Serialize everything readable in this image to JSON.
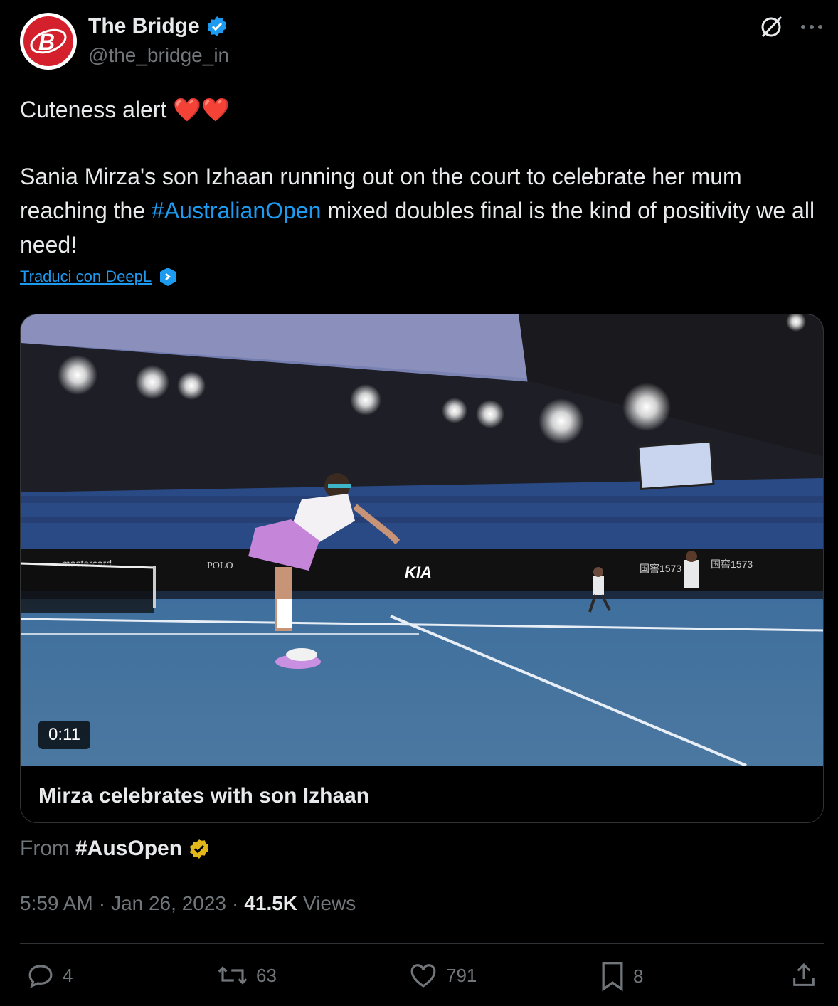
{
  "author": {
    "display_name": "The Bridge",
    "handle": "@the_bridge_in",
    "avatar_icon": "the-bridge-logo",
    "verified_color": "#1d9bf0"
  },
  "tweet": {
    "line1": "Cuteness alert ❤️❤️",
    "body_part1": "Sania Mirza's son Izhaan running out on the court to celebrate her mum reaching the ",
    "hashtag": "#AustralianOpen",
    "body_part2": " mixed doubles final is the kind of positivity we all need!",
    "translate_label": "Traduci con DeepL"
  },
  "media": {
    "duration": "0:11",
    "title": "Mirza celebrates with son Izhaan"
  },
  "source": {
    "prefix": "From",
    "name": "#AusOpen",
    "badge_color": "#e2b719"
  },
  "meta": {
    "time": "5:59 AM",
    "date": "Jan 26, 2023",
    "views_count": "41.5K",
    "views_label": "Views"
  },
  "actions": {
    "replies": "4",
    "reposts": "63",
    "likes": "791",
    "bookmarks": "8"
  }
}
